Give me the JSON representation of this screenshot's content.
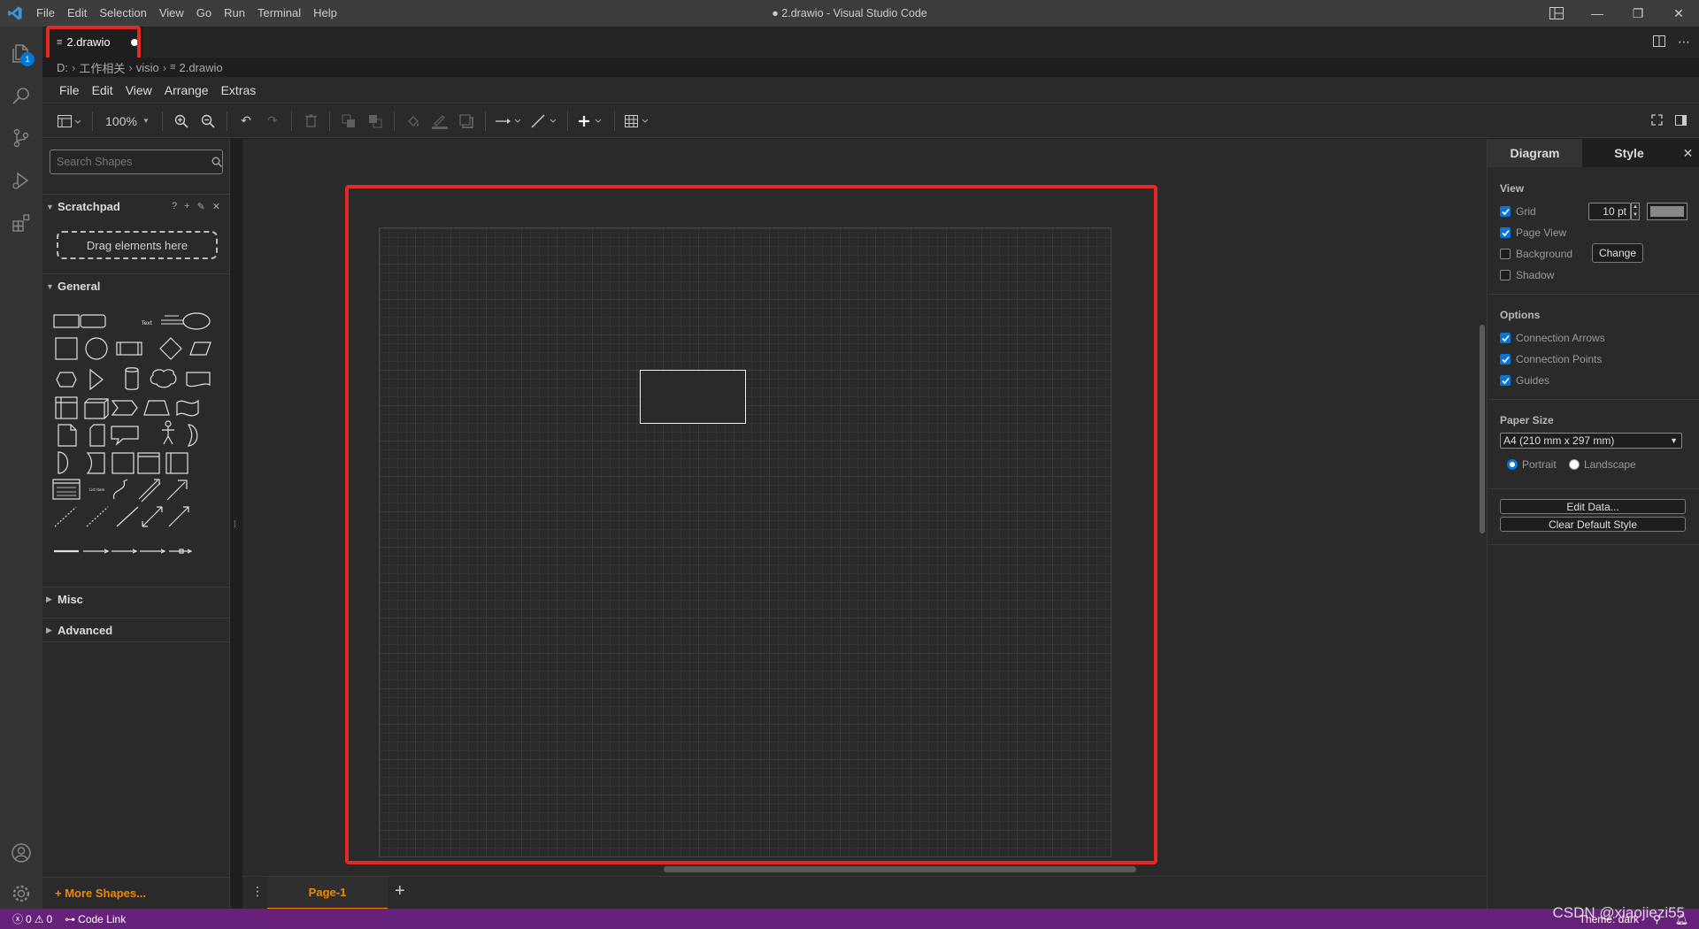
{
  "window": {
    "title": "● 2.drawio - Visual Studio Code",
    "menu": [
      "File",
      "Edit",
      "Selection",
      "View",
      "Go",
      "Run",
      "Terminal",
      "Help"
    ]
  },
  "activity": {
    "explorer_badge": "1"
  },
  "tab": {
    "label": "2.drawio"
  },
  "breadcrumb": [
    "D:",
    "工作相关",
    "visio",
    "2.drawio"
  ],
  "drawio_menu": [
    "File",
    "Edit",
    "View",
    "Arrange",
    "Extras"
  ],
  "toolbar": {
    "zoom": "100%"
  },
  "left": {
    "search_placeholder": "Search Shapes",
    "scratchpad": "Scratchpad",
    "scratchpad_help": "?",
    "drop_hint": "Drag elements here",
    "general": "General",
    "misc": "Misc",
    "advanced": "Advanced",
    "more_shapes": "+ More Shapes...",
    "shape_text": "Text",
    "shape_list": "List Item"
  },
  "pages": {
    "current": "Page-1"
  },
  "right": {
    "tab_diagram": "Diagram",
    "tab_style": "Style",
    "view_title": "View",
    "grid": "Grid",
    "grid_size": "10 pt",
    "page_view": "Page View",
    "background": "Background",
    "change": "Change",
    "shadow": "Shadow",
    "options_title": "Options",
    "connection_arrows": "Connection Arrows",
    "connection_points": "Connection Points",
    "guides": "Guides",
    "paper_size_title": "Paper Size",
    "paper_size": "A4 (210 mm x 297 mm)",
    "portrait": "Portrait",
    "landscape": "Landscape",
    "edit_data": "Edit Data...",
    "clear_default_style": "Clear Default Style"
  },
  "status": {
    "errors": "0",
    "warnings": "0",
    "code_link": "Code Link",
    "theme": "Theme: dark"
  },
  "watermark": "CSDN @xiaojiezi55",
  "colors": {
    "accent_orange": "#f08705",
    "status_bar": "#68217a",
    "highlight_red": "#e52822",
    "checkbox_blue": "#0a74d9"
  }
}
